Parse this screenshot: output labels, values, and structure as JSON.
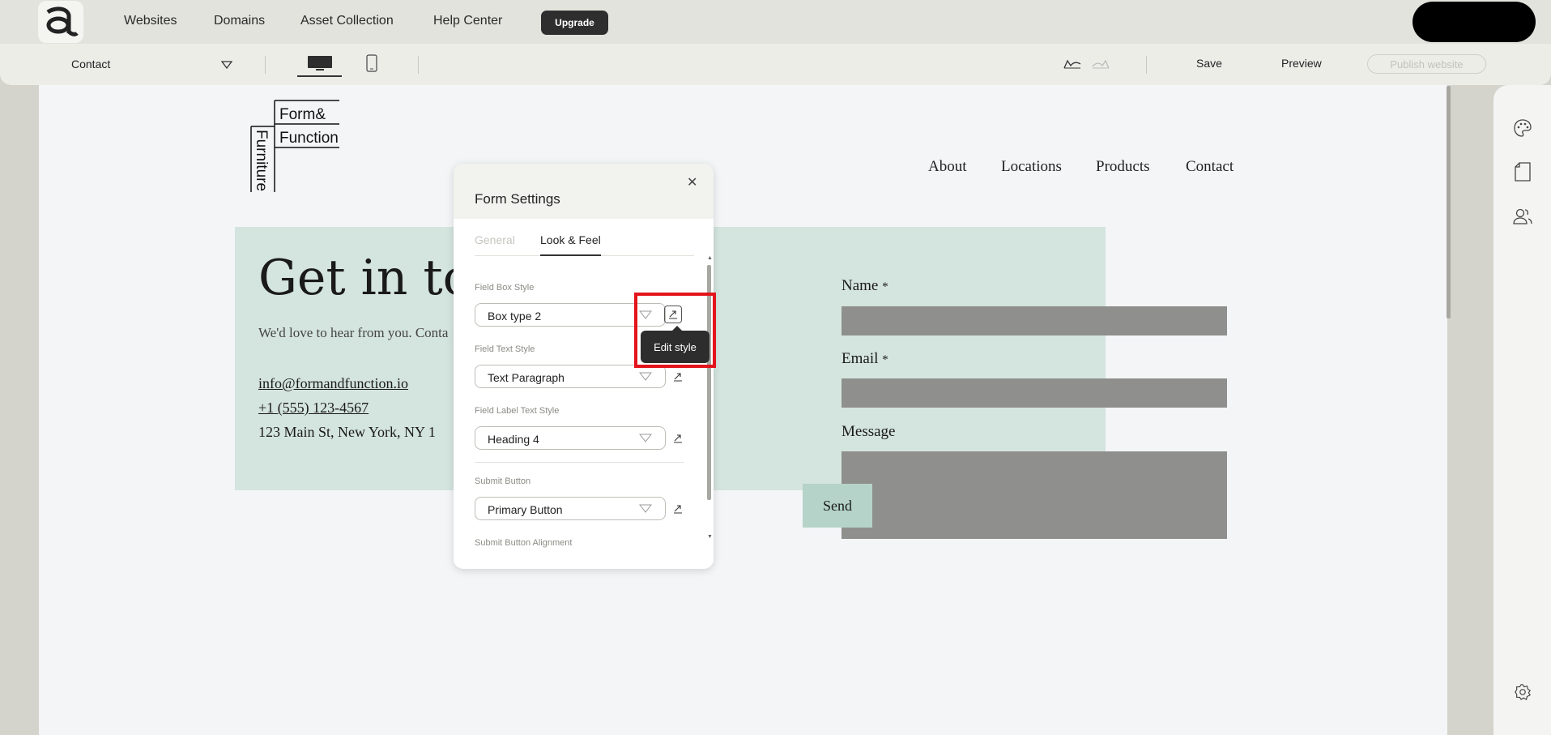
{
  "topnav": {
    "links": [
      "Websites",
      "Domains",
      "Asset Collection",
      "Help Center"
    ],
    "upgrade_label": "Upgrade"
  },
  "toolbar": {
    "page_name": "Contact",
    "save_label": "Save",
    "preview_label": "Preview",
    "publish_label": "Publish website"
  },
  "site": {
    "logo": {
      "line1": "Form&",
      "line2": "Function",
      "vertical": "Furniture"
    },
    "nav": [
      "About",
      "Locations",
      "Products",
      "Contact"
    ],
    "hero": {
      "title": "Get in to",
      "subtitle": "We'd love to hear from you. Conta",
      "email": "info@formandfunction.io",
      "phone": "+1 (555) 123-4567",
      "address": "123 Main St, New York, NY 1"
    },
    "form": {
      "name_label": "Name",
      "email_label": "Email",
      "message_label": "Message",
      "required_mark": "*",
      "send_label": "Send"
    }
  },
  "modal": {
    "title": "Form Settings",
    "tabs": [
      "General",
      "Look & Feel"
    ],
    "active_tab": "Look & Feel",
    "sections": [
      {
        "label": "Field Box Style",
        "value": "Box type 2"
      },
      {
        "label": "Field Text Style",
        "value": "Text Paragraph"
      },
      {
        "label": "Field Label Text Style",
        "value": "Heading 4"
      },
      {
        "label": "Submit Button",
        "value": "Primary Button"
      },
      {
        "label": "Submit Button Alignment"
      }
    ],
    "tooltip": "Edit style"
  },
  "colors": {
    "hero_bg": "#d4e4de",
    "field_bg": "#8f8f8e",
    "send_bg": "#b5d3c8",
    "highlight": "#e3141b"
  },
  "icons": [
    "palette-icon",
    "page-icon",
    "users-icon",
    "gear-icon",
    "undo-icon",
    "redo-icon",
    "desktop-icon",
    "mobile-icon",
    "edit-style-icon"
  ]
}
